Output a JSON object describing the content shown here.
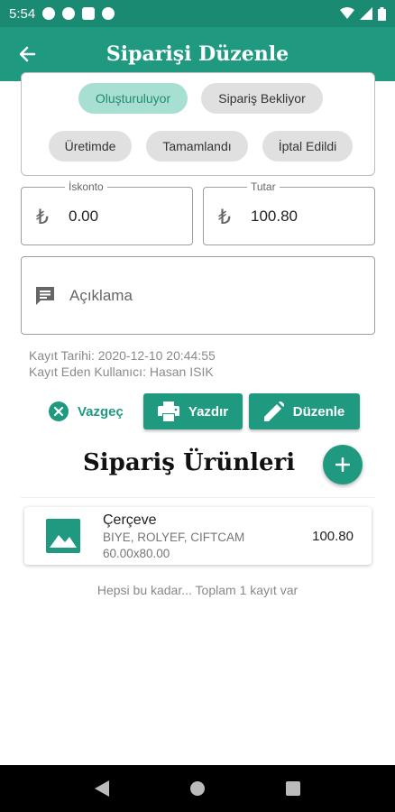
{
  "status_bar": {
    "time": "5:54"
  },
  "app_bar": {
    "title": "Siparişi Düzenle"
  },
  "status_chips": [
    {
      "label": "Oluşturuluyor",
      "selected": true
    },
    {
      "label": "Sipariş Bekliyor",
      "selected": false
    },
    {
      "label": "Üretimde",
      "selected": false
    },
    {
      "label": "Tamamlandı",
      "selected": false
    },
    {
      "label": "İptal Edildi",
      "selected": false
    }
  ],
  "discount": {
    "label": "İskonto",
    "currency": "₺",
    "value": "0.00"
  },
  "total": {
    "label": "Tutar",
    "currency": "₺",
    "value": "100.80"
  },
  "description": {
    "placeholder": "Açıklama"
  },
  "record": {
    "date_line": "Kayıt Tarihi: 2020-12-10 20:44:55",
    "user_line": "Kayıt Eden Kullanıcı: Hasan ISIK"
  },
  "actions": {
    "cancel": "Vazgeç",
    "print": "Yazdır",
    "edit": "Düzenle"
  },
  "products_section": {
    "title": "Sipariş Ürünleri"
  },
  "products": [
    {
      "name": "Çerçeve",
      "details": "BIYE, ROLYEF, CIFTCAM",
      "size": "60.00x80.00",
      "price": "100.80"
    }
  ],
  "footer_note": "Hepsi bu kadar... Toplam 1 kayıt var",
  "colors": {
    "primary": "#1f9a80",
    "status_bar": "#1a8a72",
    "chip_selected": "#a8dfd3",
    "chip_default": "#e0e0e0"
  }
}
